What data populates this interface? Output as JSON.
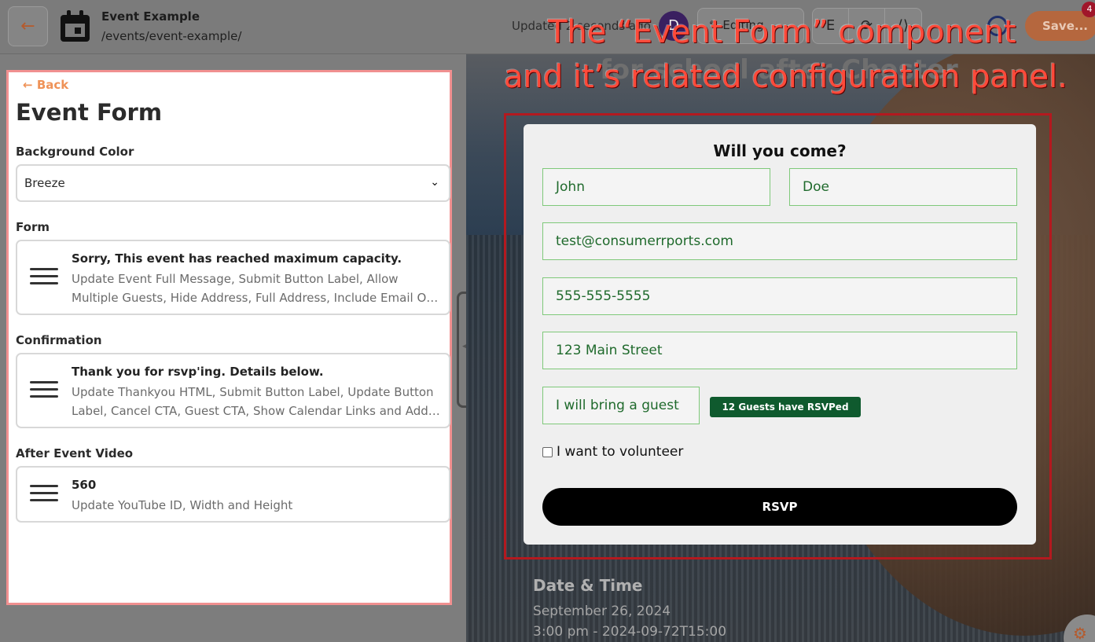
{
  "topbar": {
    "back_icon": "arrow-left-icon",
    "page_icon": "calendar-icon",
    "title": "Event Example",
    "path": "/events/event-example/",
    "update_text": "Updated 2 seconds ago",
    "avatar_initial": "D",
    "edit_label": "Editing",
    "tool_icons": [
      "E",
      "⟳",
      "⟨⟩"
    ],
    "save_label": "Save...",
    "notification_count": "4"
  },
  "panel": {
    "back_label": "Back",
    "title": "Event Form",
    "background_color": {
      "label": "Background Color",
      "value": "Breeze"
    },
    "form": {
      "label": "Form",
      "title": "Sorry, This event has reached maximum capacity.",
      "description": "Update Event Full Message, Submit Button Label, Allow Multiple Guests, Hide Address, Full Address, Include Email Opt In, Include Phone Number, Include Volunteer"
    },
    "confirmation": {
      "label": "Confirmation",
      "title": "Thank you for rsvp'ing. Details below.",
      "description": "Update Thankyou HTML, Submit Button Label, Update Button Label, Cancel CTA, Guest CTA, Show Calendar Links and Add to Calendar"
    },
    "after_event_video": {
      "label": "After Event Video",
      "title": "560",
      "description": "Update YouTube ID, Width and Height"
    }
  },
  "preview": {
    "banner_text": "for school after Chester",
    "form": {
      "heading": "Will you come?",
      "first_name": "John",
      "last_name": "Doe",
      "email": "test@consumerrports.com",
      "phone": "555-555-5555",
      "address": "123 Main Street",
      "guest": "I will bring a guest",
      "guests_badge": "12 Guests have RSVPed",
      "volunteer_label": "I want to volunteer",
      "volunteer_checked": false,
      "submit_label": "RSVP"
    },
    "date_time": {
      "heading": "Date & Time",
      "date": "September 26, 2024",
      "time": "3:00 pm - 2024-09-72T15:00"
    }
  },
  "annotation": {
    "line1": "The “Event Form” component",
    "line2": "and it’s related configuration panel."
  },
  "colors": {
    "accent": "#ef9257",
    "panel_border": "#f19090",
    "form_outline": "#b3191f",
    "input_border": "#7fc97a",
    "input_text": "#1f6a2c",
    "badge_bg": "#0f5a2e",
    "annotation": "#ff4a3a"
  }
}
